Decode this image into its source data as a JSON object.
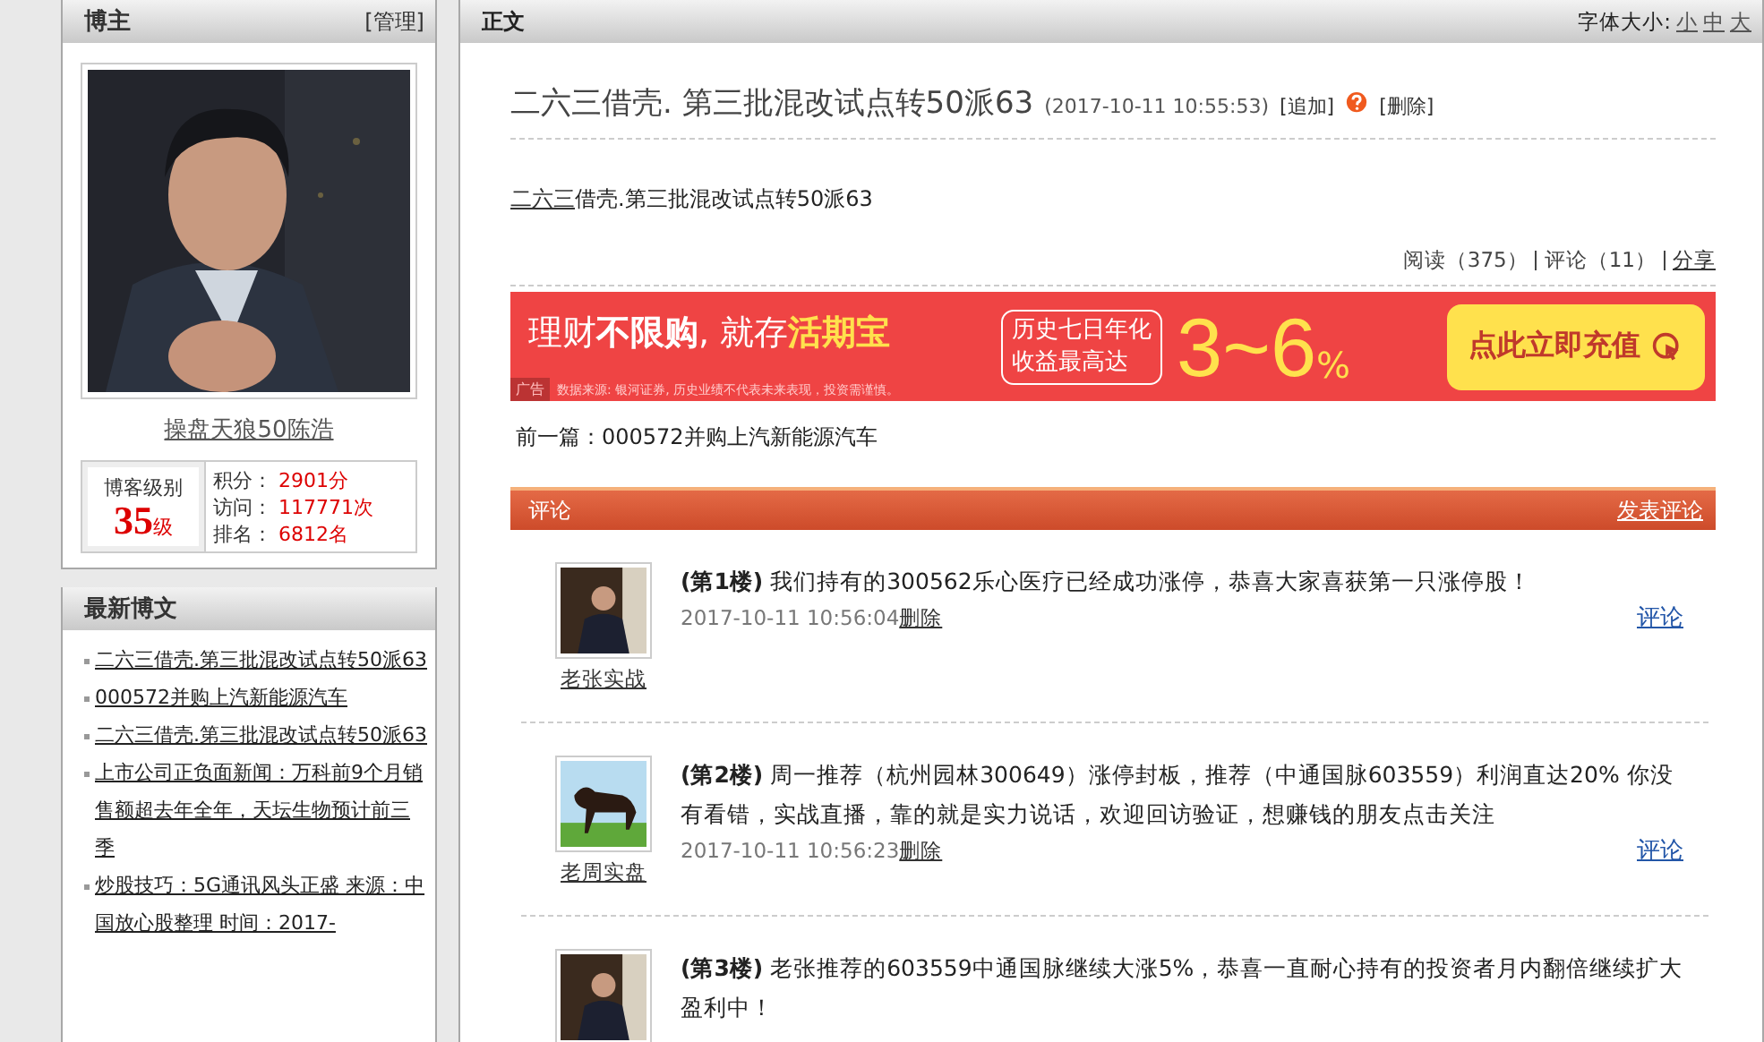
{
  "sidebar": {
    "profile": {
      "title": "博主",
      "manage": "[管理]",
      "name": "操盘天狼50陈浩",
      "level_label": "博客级别",
      "level": "35",
      "level_unit": "级",
      "stats": [
        {
          "label": "积分：",
          "value": "2901分"
        },
        {
          "label": "访问：",
          "value": "117771次"
        },
        {
          "label": "排名：",
          "value": "6812名"
        }
      ]
    },
    "recent": {
      "title": "最新博文",
      "items": [
        "二六三借壳.第三批混改试点转50派63",
        "000572并购上汽新能源汽车",
        "二六三借壳.第三批混改试点转50派63",
        "上市公司正负面新闻：万科前9个月销售额超去年全年，天坛生物预计前三季",
        "炒股技巧：5G通讯风头正盛 来源：中国放心股整理 时间：2017-"
      ]
    }
  },
  "article": {
    "header": "正文",
    "font_size_label": "字体大小:",
    "font_sizes": [
      "小",
      "中",
      "大"
    ],
    "title": "二六三借壳. 第三批混改试点转50派63",
    "time": "(2017-10-11 10:55:53)",
    "append": "[追加]",
    "delete": "[删除]",
    "body_link": "二六三",
    "body_text": "借壳.第三批混改试点转50派63",
    "reads": "阅读（375）",
    "comments_count": "评论（11）",
    "share": "分享",
    "ad": {
      "part1": "理财",
      "part2": "不限购",
      "part3": ", 就存",
      "part4": "活期宝",
      "box": [
        "历史七日年化",
        "收益最高达"
      ],
      "rate": "3~6",
      "percent": "%",
      "button": "点此立即充值",
      "tag": "广告",
      "note": "数据来源: 银河证券, 历史业绩不代表未来表现，投资需谨慎。"
    },
    "previous": "前一篇：000572并购上汽新能源汽车"
  },
  "comments": {
    "title": "评论",
    "post": "发表评论",
    "items": [
      {
        "user": "老张实战",
        "floor": "(第1楼)",
        "text": "我们持有的300562乐心医疗已经成功涨停，恭喜大家喜获第一只涨停股！",
        "time": "2017-10-11 10:56:04",
        "delete": "删除",
        "reply": "评论"
      },
      {
        "user": "老周实盘",
        "floor": "(第2楼)",
        "text": "周一推荐（杭州园林300649）涨停封板，推荐（中通国脉603559）利润直达20% 你没有看错，实战直播，靠的就是实力说话，欢迎回访验证，想赚钱的朋友点击关注",
        "time": "2017-10-11 10:56:23",
        "delete": "删除",
        "reply": "评论"
      },
      {
        "floor": "(第3楼)",
        "text": "老张推荐的603559中通国脉继续大涨5%，恭喜一直耐心持有的投资者月内翻倍继续扩大盈利中！"
      }
    ]
  }
}
